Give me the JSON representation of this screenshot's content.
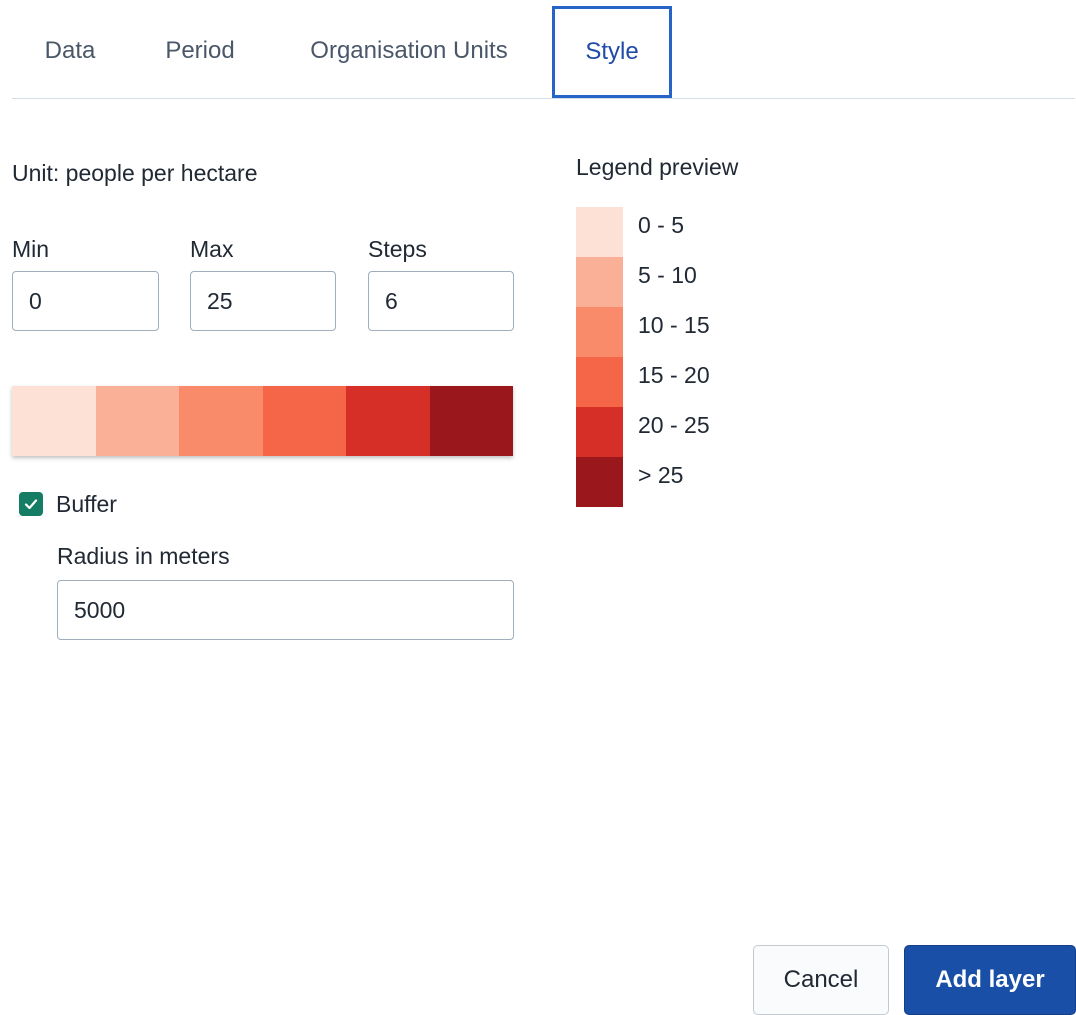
{
  "tabs": {
    "data": "Data",
    "period": "Period",
    "org_units": "Organisation Units",
    "style": "Style",
    "active": "Style"
  },
  "style_panel": {
    "unit_label": "Unit: people per hectare",
    "min": {
      "label": "Min",
      "value": "0"
    },
    "max": {
      "label": "Max",
      "value": "25"
    },
    "steps": {
      "label": "Steps",
      "value": "6"
    },
    "color_scale": [
      "#fde0d6",
      "#f9b096",
      "#f98a6a",
      "#f56547",
      "#d62f28",
      "#9a171c"
    ],
    "buffer": {
      "label": "Buffer",
      "checked": true,
      "radius_label": "Radius in meters",
      "radius_value": "5000"
    }
  },
  "legend": {
    "title": "Legend preview",
    "items": [
      {
        "label": "0 - 5",
        "color": "#fde0d6"
      },
      {
        "label": "5 - 10",
        "color": "#f9b096"
      },
      {
        "label": "10 - 15",
        "color": "#f98a6a"
      },
      {
        "label": "15 - 20",
        "color": "#f56547"
      },
      {
        "label": "20 - 25",
        "color": "#d62f28"
      },
      {
        "label": "> 25",
        "color": "#9a171c"
      }
    ]
  },
  "actions": {
    "cancel": "Cancel",
    "add_layer": "Add layer"
  },
  "colors": {
    "accent": "#1a4fa8",
    "active_tab_border": "#2764c8",
    "checkbox": "#147d64"
  }
}
